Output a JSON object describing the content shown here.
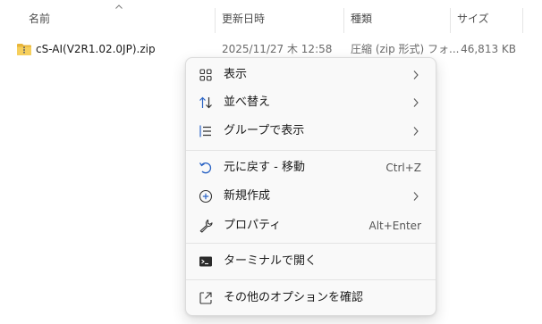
{
  "columns": {
    "name": "名前",
    "date": "更新日時",
    "type": "種類",
    "size": "サイズ"
  },
  "file": {
    "name": "cS-AI(V2R1.02.0JP).zip",
    "date": "2025/11/27 木 12:58",
    "type": "圧縮 (zip 形式) フォ...",
    "size": "46,813 KB",
    "icon": "zip-folder-icon"
  },
  "menu": {
    "view": {
      "label": "表示",
      "icon": "grid-icon"
    },
    "sort": {
      "label": "並べ替え",
      "icon": "sort-icon"
    },
    "group": {
      "label": "グループで表示",
      "icon": "group-list-icon"
    },
    "undo": {
      "label": "元に戻す - 移動",
      "shortcut": "Ctrl+Z",
      "icon": "undo-icon"
    },
    "new": {
      "label": "新規作成",
      "icon": "add-circle-icon"
    },
    "properties": {
      "label": "プロパティ",
      "shortcut": "Alt+Enter",
      "icon": "wrench-icon"
    },
    "terminal": {
      "label": "ターミナルで開く",
      "icon": "terminal-icon"
    },
    "more": {
      "label": "その他のオプションを確認",
      "icon": "share-icon"
    }
  },
  "colors": {
    "accent": "#2a63c4",
    "zip_folder": "#f2c94c"
  }
}
